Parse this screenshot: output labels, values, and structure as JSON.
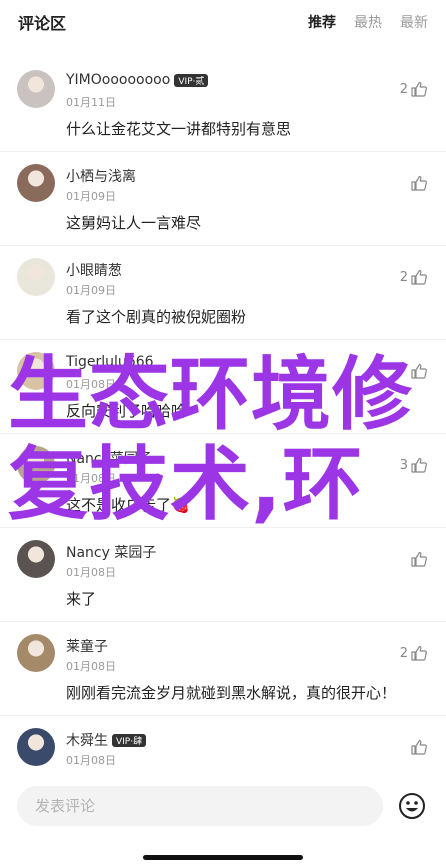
{
  "header": {
    "title": "评论区",
    "tabs": [
      {
        "label": "推荐",
        "active": true
      },
      {
        "label": "最热",
        "active": false
      },
      {
        "label": "最新",
        "active": false
      }
    ]
  },
  "comments": [
    {
      "name": "YIMOoooooooo",
      "vip": "VIP·贰",
      "date": "01月11日",
      "text": "什么让金花艾文一讲都特别有意思",
      "likes": "2",
      "avatar_color": "#c9c2c0"
    },
    {
      "name": "小栖与浅离",
      "vip": "",
      "date": "01月09日",
      "text": "这舅妈让人一言难尽",
      "likes": "",
      "avatar_color": "#8a6a5a"
    },
    {
      "name": "小眼睛葱",
      "vip": "",
      "date": "01月09日",
      "text": "看了这个剧真的被倪妮圈粉",
      "likes": "2",
      "avatar_color": "#e9e6dc"
    },
    {
      "name": "Tigerlulu666",
      "vip": "",
      "date": "01月08日",
      "text": "反向安利了哈哈哈",
      "likes": "",
      "avatar_color": "#d8c3a5"
    },
    {
      "name": "Nancy菜园子",
      "vip": "",
      "date": "01月08日",
      "text": "这不是收广告了🍓",
      "likes": "3",
      "avatar_color": "#b9a48e"
    },
    {
      "name": "Nancy 菜园子",
      "vip": "",
      "date": "01月08日",
      "text": "来了",
      "likes": "",
      "avatar_color": "#5b5352"
    },
    {
      "name": "莱童子",
      "vip": "",
      "date": "01月08日",
      "text": "刚刚看完流金岁月就碰到黑水解说，真的很开心！",
      "likes": "2",
      "avatar_color": "#a58a6a"
    },
    {
      "name": "木舜生",
      "vip": "VIP·肆",
      "date": "01月08日",
      "text": "",
      "likes": "",
      "avatar_color": "#3a4a6a"
    }
  ],
  "input": {
    "placeholder": "发表评论"
  },
  "watermark": {
    "line1": "生态环境修",
    "line2": "复技术,环"
  },
  "colors": {
    "watermark": "#9b35e6"
  }
}
